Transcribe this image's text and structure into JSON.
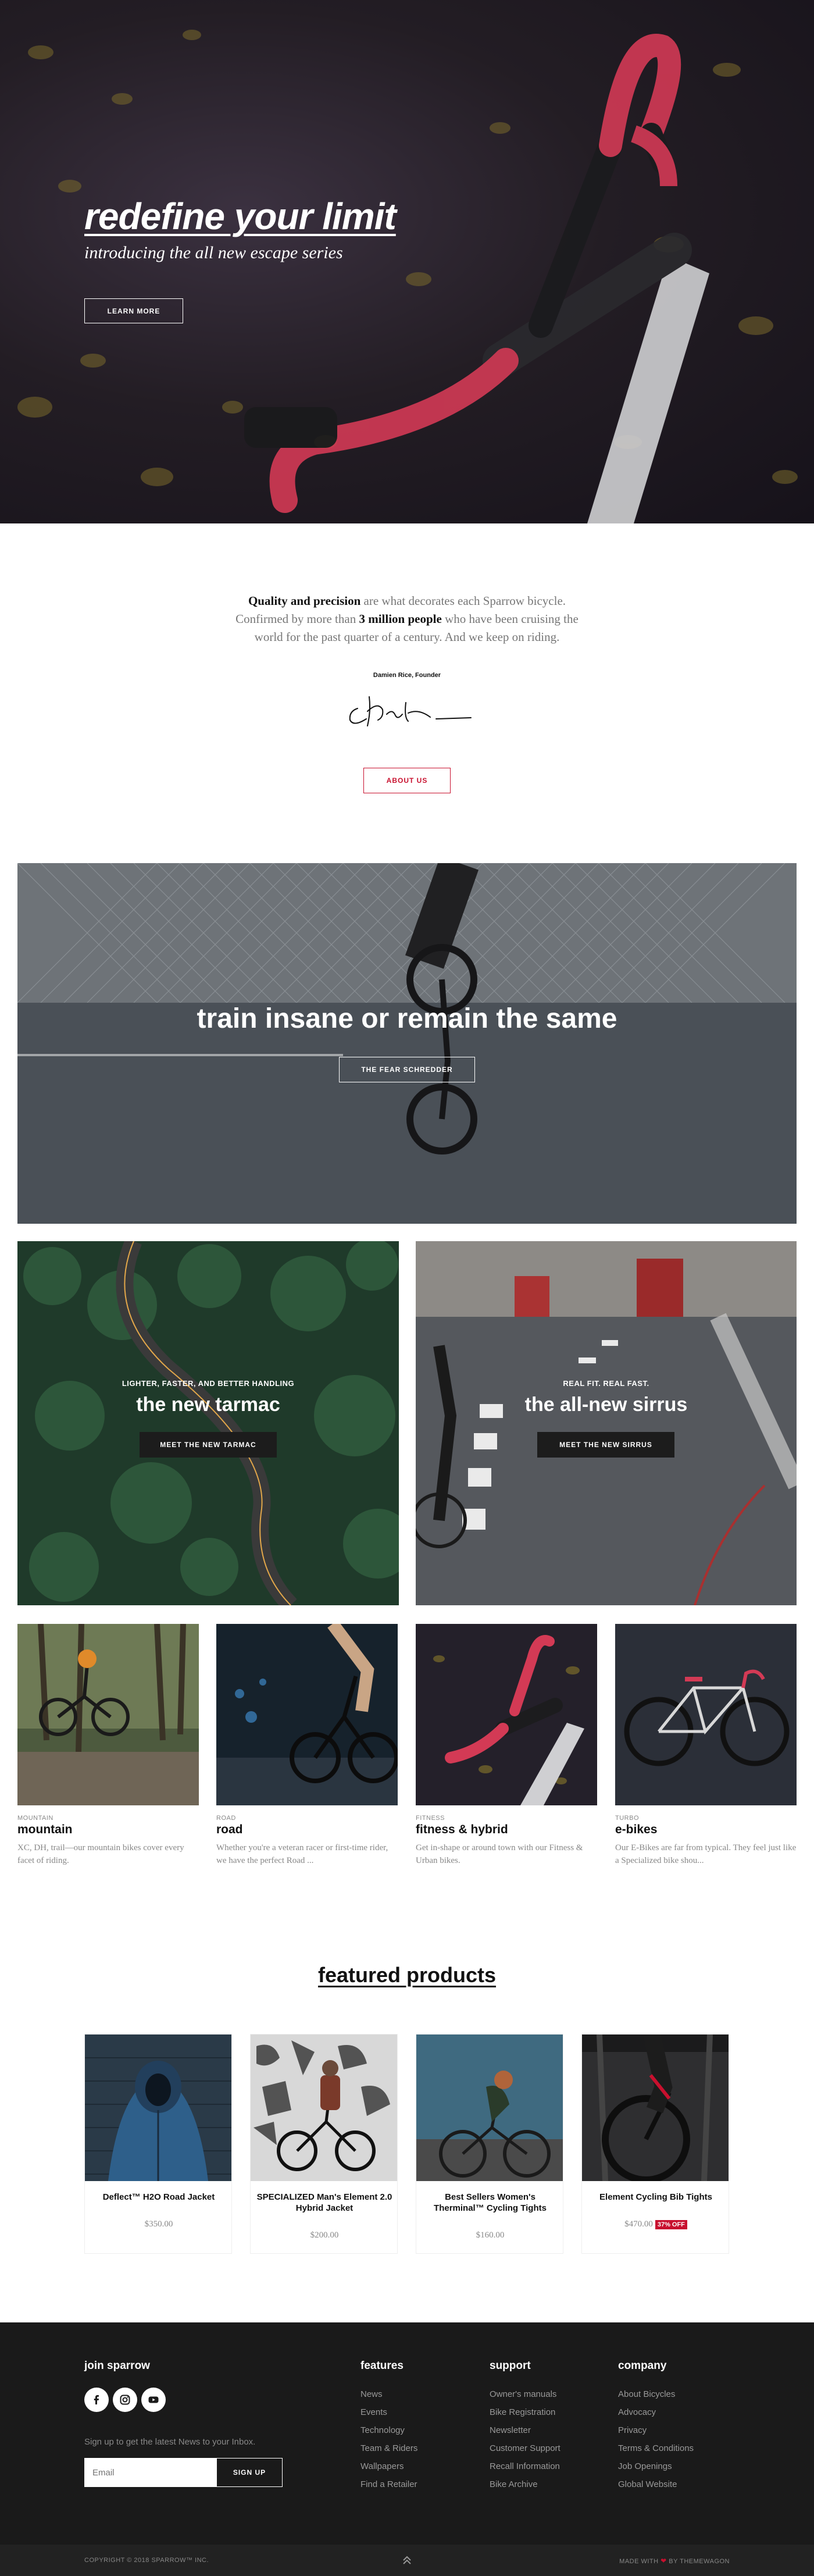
{
  "hero": {
    "title": "redefine your limit",
    "subtitle": "introducing the all new escape series",
    "button": "LEARN MORE"
  },
  "intro": {
    "strong1": "Quality and precision",
    "text1": " are what decorates each Sparrow bicycle. Confirmed by more than ",
    "strong2": "3 million people",
    "text2": " who have been cruising the world for the past quarter of a century. And we keep on riding.",
    "founder": "Damien Rice, Founder",
    "about_button": "ABOUT US"
  },
  "banner_main": {
    "title": "train insane or remain the same",
    "button": "THE FEAR SCHREDDER"
  },
  "banner_left": {
    "eyebrow": "LIGHTER, FASTER, AND BETTER HANDLING",
    "title": "the new tarmac",
    "button": "MEET THE NEW TARMAC"
  },
  "banner_right": {
    "eyebrow": "REAL FIT. REAL FAST.",
    "title": "the all-new sirrus",
    "button": "MEET THE NEW SIRRUS"
  },
  "categories": [
    {
      "eyebrow": "MOUNTAIN",
      "name": "mountain",
      "desc": "XC, DH, trail—our mountain bikes cover every facet of riding."
    },
    {
      "eyebrow": "ROAD",
      "name": "road",
      "desc": "Whether you're a veteran racer or first-time rider, we have the perfect Road ..."
    },
    {
      "eyebrow": "FITNESS",
      "name": "fitness & hybrid",
      "desc": "Get in-shape or around town with our Fitness & Urban bikes."
    },
    {
      "eyebrow": "TURBO",
      "name": "e-bikes",
      "desc": "Our E-Bikes are far from typical. They feel just like a Specialized bike shou..."
    }
  ],
  "featured": {
    "title": "featured products",
    "products": [
      {
        "name": "Deflect™ H2O Road Jacket",
        "price": "$350.00",
        "badge": ""
      },
      {
        "name": "SPECIALIZED Man's Element 2.0 Hybrid Jacket",
        "price": "$200.00",
        "badge": ""
      },
      {
        "name": "Best Sellers Women's Therminal™ Cycling Tights",
        "price": "$160.00",
        "badge": ""
      },
      {
        "name": "Element Cycling Bib Tights",
        "price": "$470.00",
        "badge": "37% OFF"
      }
    ]
  },
  "footer": {
    "join_title": "join sparrow",
    "signup_text": "Sign up to get the latest News to your Inbox.",
    "email_placeholder": "Email",
    "signup_button": "SIGN UP",
    "features_title": "features",
    "features": [
      "News",
      "Events",
      "Technology",
      "Team & Riders",
      "Wallpapers",
      "Find a Retailer"
    ],
    "support_title": "support",
    "support": [
      "Owner's manuals",
      "Bike Registration",
      "Newsletter",
      "Customer Support",
      "Recall Information",
      "Bike Archive"
    ],
    "company_title": "company",
    "company": [
      "About Bicycles",
      "Advocacy",
      "Privacy",
      "Terms & Conditions",
      "Job Openings",
      "Global Website"
    ],
    "copyright": "COPYRIGHT © 2018 SPARROW™ INC.",
    "made_with": "MADE WITH",
    "by": "BY THEMEWAGON"
  },
  "colors": {
    "accent": "#c8102e",
    "footer_bg": "#1a1a1a"
  },
  "icons": [
    "facebook-icon",
    "instagram-icon",
    "youtube-icon",
    "chevrons-up-icon",
    "heart-icon"
  ]
}
